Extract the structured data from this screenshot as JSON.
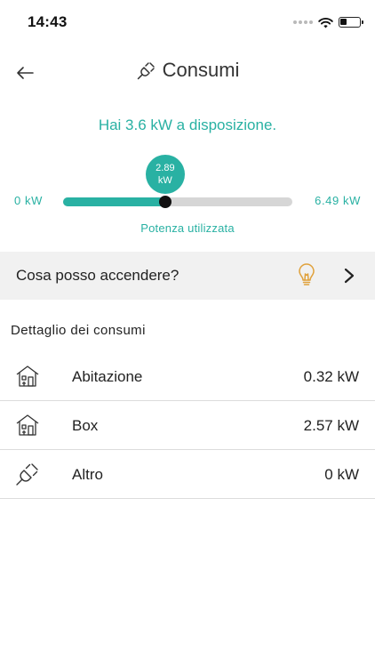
{
  "status_bar": {
    "time": "14:43",
    "icons": [
      "signal-dots-icon",
      "wifi-icon",
      "battery-icon"
    ],
    "battery_level": 0.35
  },
  "header": {
    "title": "Consumi",
    "back_icon": "arrow-left-icon",
    "title_icon": "plug-icon"
  },
  "power": {
    "available_text": "Hai 3.6 kW a disposizione.",
    "min_label": "0 kW",
    "max_label": "6.49 kW",
    "used_value": "2.89",
    "used_unit": "kW",
    "used_kw": 2.89,
    "max_kw": 6.49,
    "used_label": "Potenza utilizzata"
  },
  "suggestion": {
    "label": "Cosa posso accendere?",
    "icon": "lightbulb-icon",
    "chevron": "chevron-right-icon"
  },
  "details": {
    "title": "Dettaglio dei consumi",
    "items": [
      {
        "label": "Abitazione",
        "value": "0.32 kW",
        "icon": "house-icon"
      },
      {
        "label": "Box",
        "value": "2.57 kW",
        "icon": "house-icon"
      },
      {
        "label": "Altro",
        "value": "0 kW",
        "icon": "plug-icon"
      }
    ]
  },
  "colors": {
    "accent": "#29b1a3",
    "bulb": "#e0a13b",
    "track": "#d6d6d6",
    "row_bg": "#f1f1f1"
  }
}
